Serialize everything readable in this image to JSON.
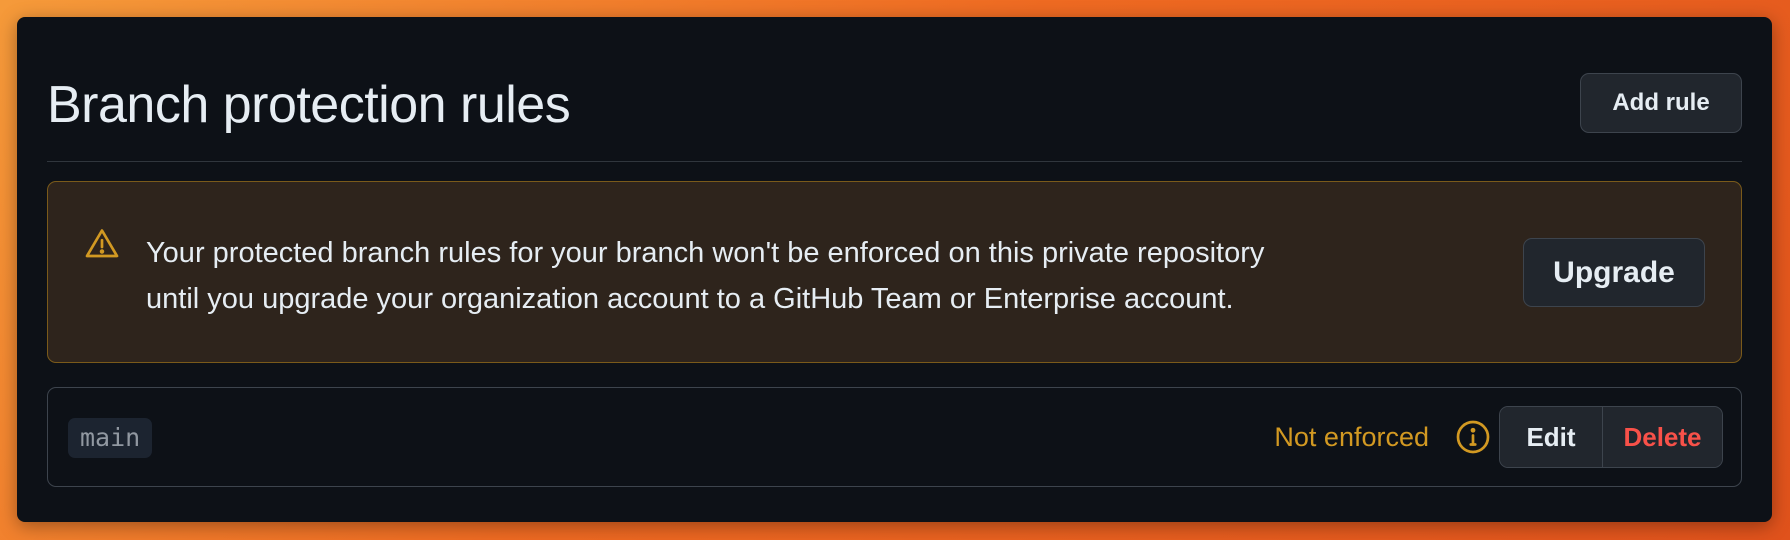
{
  "header": {
    "title": "Branch protection rules",
    "add_rule_label": "Add rule"
  },
  "alert": {
    "icon": "alert-triangle-icon",
    "line1": "Your protected branch rules for your branch won't be enforced on this private repository",
    "line2": "until you upgrade your organization account to a GitHub Team or Enterprise account.",
    "upgrade_label": "Upgrade"
  },
  "rules": {
    "items": [
      {
        "branch": "main",
        "status": "Not enforced",
        "status_icon": "info-icon",
        "edit_label": "Edit",
        "delete_label": "Delete"
      }
    ]
  },
  "colors": {
    "background": "#0d1117",
    "warning": "#d29922",
    "danger": "#f85149",
    "text": "#e6edf3",
    "border": "#3d444d"
  }
}
